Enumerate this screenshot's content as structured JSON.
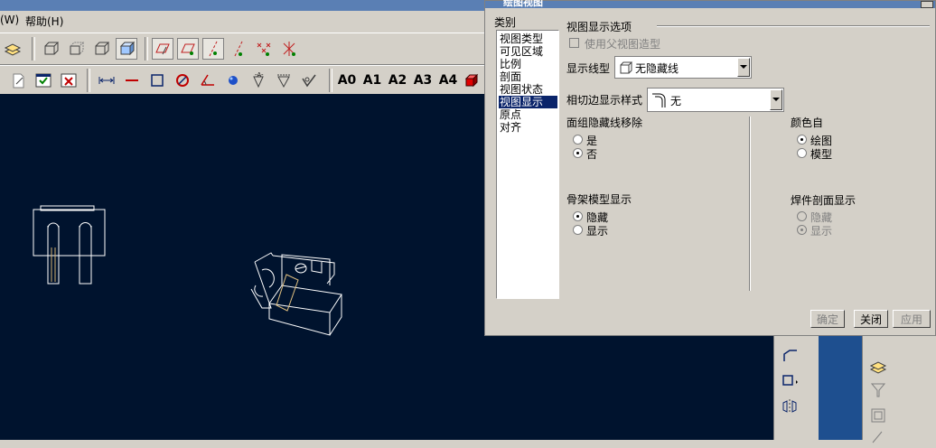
{
  "menubar": {
    "items": [
      {
        "label": "(W)"
      },
      {
        "label": "帮助(H)"
      }
    ]
  },
  "toolbar": {
    "sheet_buttons": [
      "A0",
      "A1",
      "A2",
      "A3",
      "A4"
    ]
  },
  "dialog": {
    "title": "绘图视图",
    "category_label": "类别",
    "categories": [
      {
        "label": "视图类型"
      },
      {
        "label": "可见区域"
      },
      {
        "label": "比例"
      },
      {
        "label": "剖面"
      },
      {
        "label": "视图状态"
      },
      {
        "label": "视图显示",
        "selected": true
      },
      {
        "label": "原点"
      },
      {
        "label": "对齐"
      }
    ],
    "section_title": "视图显示选项",
    "use_parent_checkbox_label": "使用父视图造型",
    "display_style_label": "显示线型",
    "display_style_value": "无隐藏线",
    "tangent_edge_label": "相切边显示样式",
    "tangent_edge_value": "无",
    "face_group_label": "面组隐藏线移除",
    "face_group_yes": "是",
    "face_group_no": "否",
    "color_from_label": "颜色自",
    "color_from_drawing": "绘图",
    "color_from_model": "模型",
    "skeleton_label": "骨架模型显示",
    "skeleton_hide": "隐藏",
    "skeleton_show": "显示",
    "weld_label": "焊件剖面显示",
    "weld_hide": "隐藏",
    "weld_show": "显示",
    "ok_button": "确定",
    "close_button": "关闭",
    "apply_button": "应用"
  },
  "colors": {
    "canvas": "#00132e",
    "selection": "#0a246a",
    "titlebar": "#5a7fb4"
  }
}
